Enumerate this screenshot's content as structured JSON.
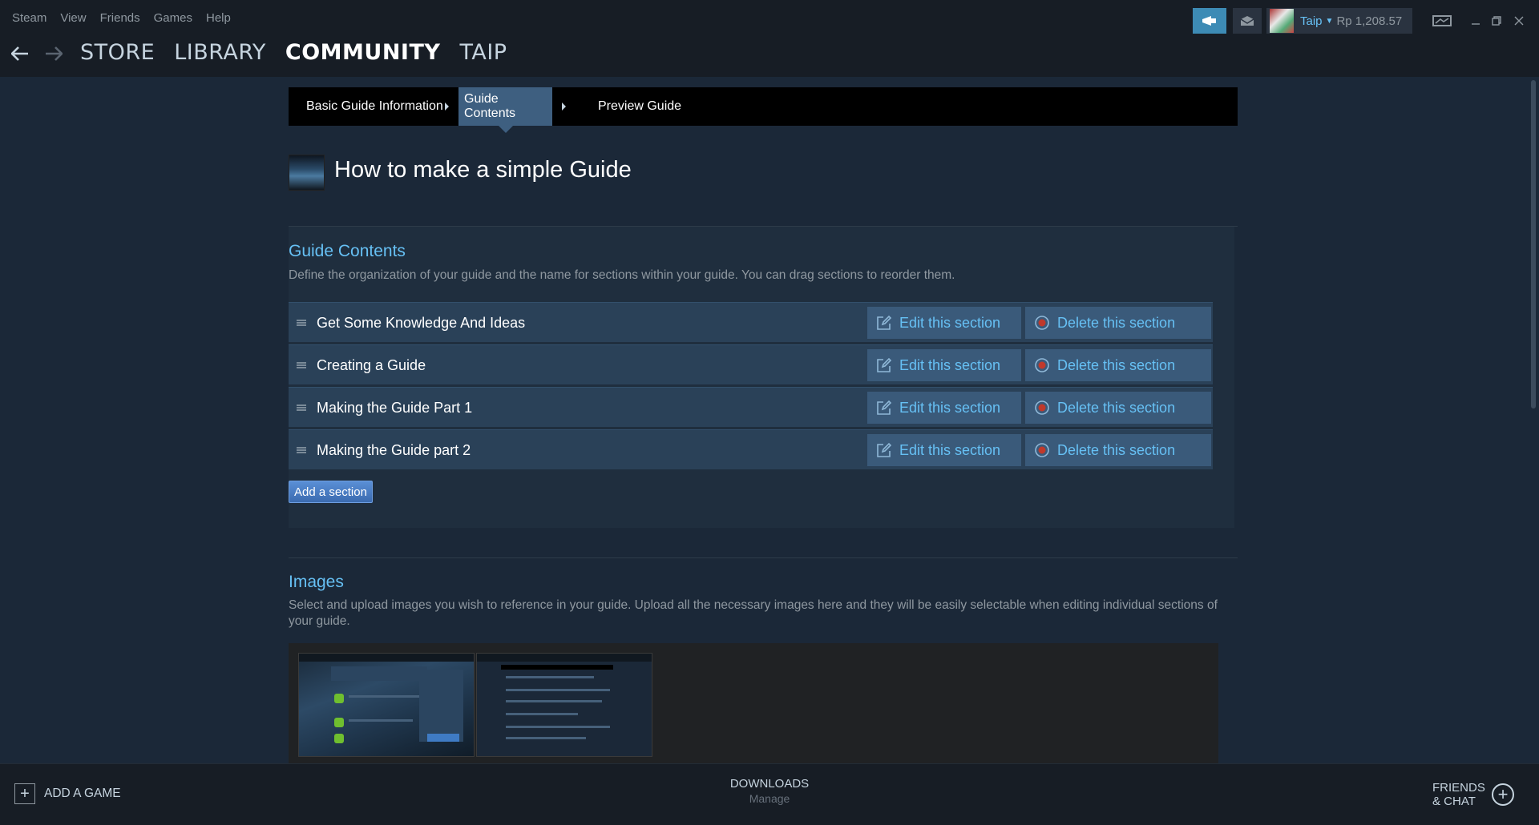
{
  "menu": {
    "items": [
      "Steam",
      "View",
      "Friends",
      "Games",
      "Help"
    ]
  },
  "nav": {
    "items": [
      "STORE",
      "LIBRARY",
      "COMMUNITY",
      "TAIP"
    ],
    "active": "COMMUNITY"
  },
  "account": {
    "name": "Taip",
    "wallet": "Rp 1,208.57"
  },
  "tabs": {
    "basic": "Basic Guide Information",
    "contents": "Guide Contents",
    "preview": "Preview Guide"
  },
  "guide": {
    "title": "How to make a simple Guide"
  },
  "contents_section": {
    "heading": "Guide Contents",
    "description": "Define the organization of your guide and the name for sections within your guide. You can drag sections to reorder them.",
    "sections": [
      {
        "name": "Get Some Knowledge And Ideas",
        "edit": "Edit this section",
        "delete": "Delete this section"
      },
      {
        "name": "Creating a Guide",
        "edit": "Edit this section",
        "delete": "Delete this section"
      },
      {
        "name": "Making the Guide Part 1",
        "edit": "Edit this section",
        "delete": "Delete this section"
      },
      {
        "name": "Making the Guide part 2",
        "edit": "Edit this section",
        "delete": "Delete this section"
      }
    ],
    "add_button": "Add a section"
  },
  "images_section": {
    "heading": "Images",
    "description": "Select and upload images you wish to reference in your guide. Upload all the necessary images here and they will be easily selectable when editing individual sections of your guide."
  },
  "bottom": {
    "add_game": "ADD A GAME",
    "downloads": "DOWNLOADS",
    "downloads_sub": "Manage",
    "friends": "FRIENDS\n& CHAT"
  },
  "colors": {
    "accent_blue": "#66c0f4",
    "background": "#1b2838",
    "active_tab": "#3e5f80",
    "delete_icon_red": "#c0392b"
  },
  "icons": {
    "back": "arrow-left-icon",
    "forward": "arrow-right-icon",
    "announce": "megaphone-icon",
    "notify": "envelope-icon",
    "edit": "pencil-square-icon",
    "delete": "circle-x-icon",
    "drag": "drag-handle-icon",
    "add": "plus-icon"
  }
}
